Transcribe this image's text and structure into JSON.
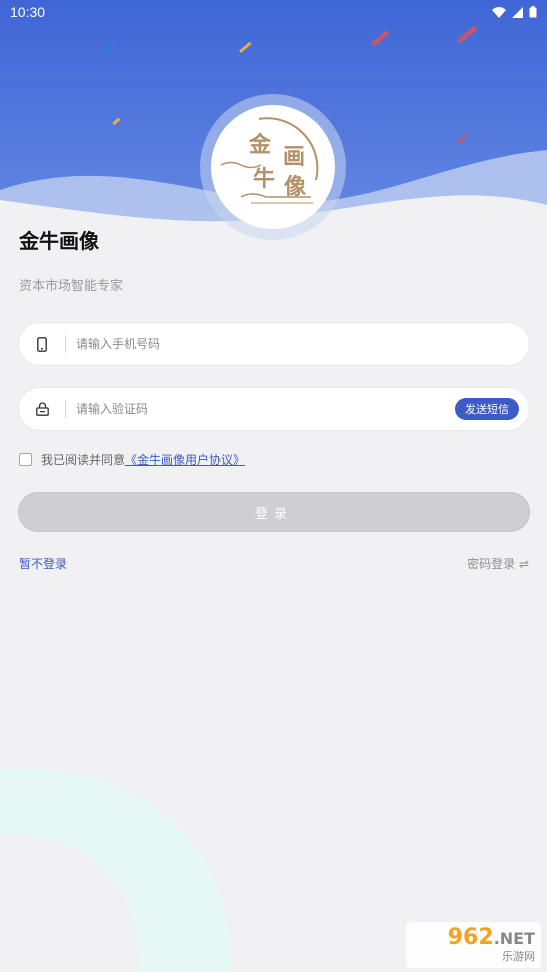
{
  "status_bar": {
    "time": "10:30"
  },
  "logo": {
    "char1": "金",
    "char2": "画",
    "char3": "牛",
    "char4": "像"
  },
  "app": {
    "title": "金牛画像",
    "subtitle": "资本市场智能专家"
  },
  "form": {
    "phone_placeholder": "请输入手机号码",
    "code_placeholder": "请输入验证码",
    "sms_button": "发送短信",
    "agree_text": "我已阅读并同意",
    "agree_link": "《金牛画像用户协议》",
    "login_button": "登录"
  },
  "links": {
    "skip": "暂不登录",
    "password_login": "密码登录 ⇌"
  },
  "watermark": {
    "top": "962",
    "top_suffix": ".NET",
    "bottom": "乐游网"
  },
  "colors": {
    "accent": "#3c5bc4",
    "header": "#4a6fd8",
    "logo_gold": "#b49068"
  }
}
